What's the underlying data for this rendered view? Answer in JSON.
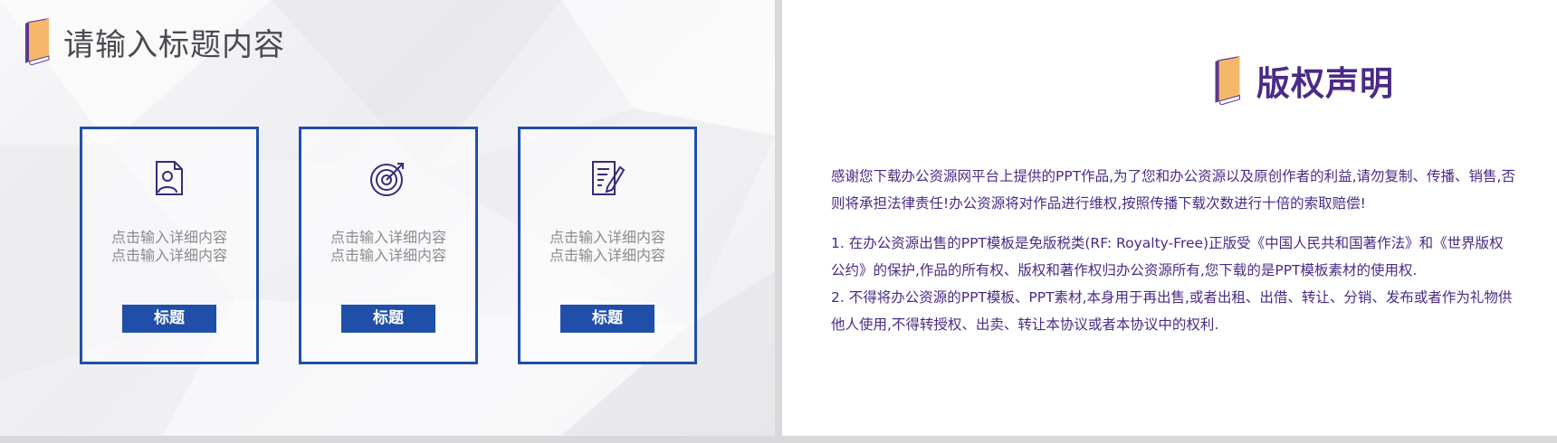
{
  "left_slide": {
    "title": "请输入标题内容",
    "cards": [
      {
        "icon": "user-document-icon",
        "line1": "点击输入详细内容",
        "line2": "点击输入详细内容",
        "button": "标题"
      },
      {
        "icon": "target-arrow-icon",
        "line1": "点击输入详细内容",
        "line2": "点击输入详细内容",
        "button": "标题"
      },
      {
        "icon": "document-edit-icon",
        "line1": "点击输入详细内容",
        "line2": "点击输入详细内容",
        "button": "标题"
      }
    ]
  },
  "right_slide": {
    "title": "版权声明",
    "paragraph1": "感谢您下载办公资源网平台上提供的PPT作品,为了您和办公资源以及原创作者的利益,请勿复制、传播、销售,否则将承担法律责任!办公资源将对作品进行维权,按照传播下载次数进行十倍的索取赔偿!",
    "paragraph2": "1. 在办公资源出售的PPT模板是免版税类(RF: Royalty-Free)正版受《中国人民共和国著作法》和《世界版权公约》的保护,作品的所有权、版权和著作权归办公资源所有,您下载的是PPT模板素材的使用权.",
    "paragraph3": "2. 不得将办公资源的PPT模板、PPT素材,本身用于再出售,或者出租、出借、转让、分销、发布或者作为礼物供他人使用,不得转授权、出卖、转让本协议或者本协议中的权利."
  },
  "colors": {
    "accent_blue": "#1f4fa8",
    "purple": "#4b2a86",
    "book_orange": "#f5b86a"
  }
}
